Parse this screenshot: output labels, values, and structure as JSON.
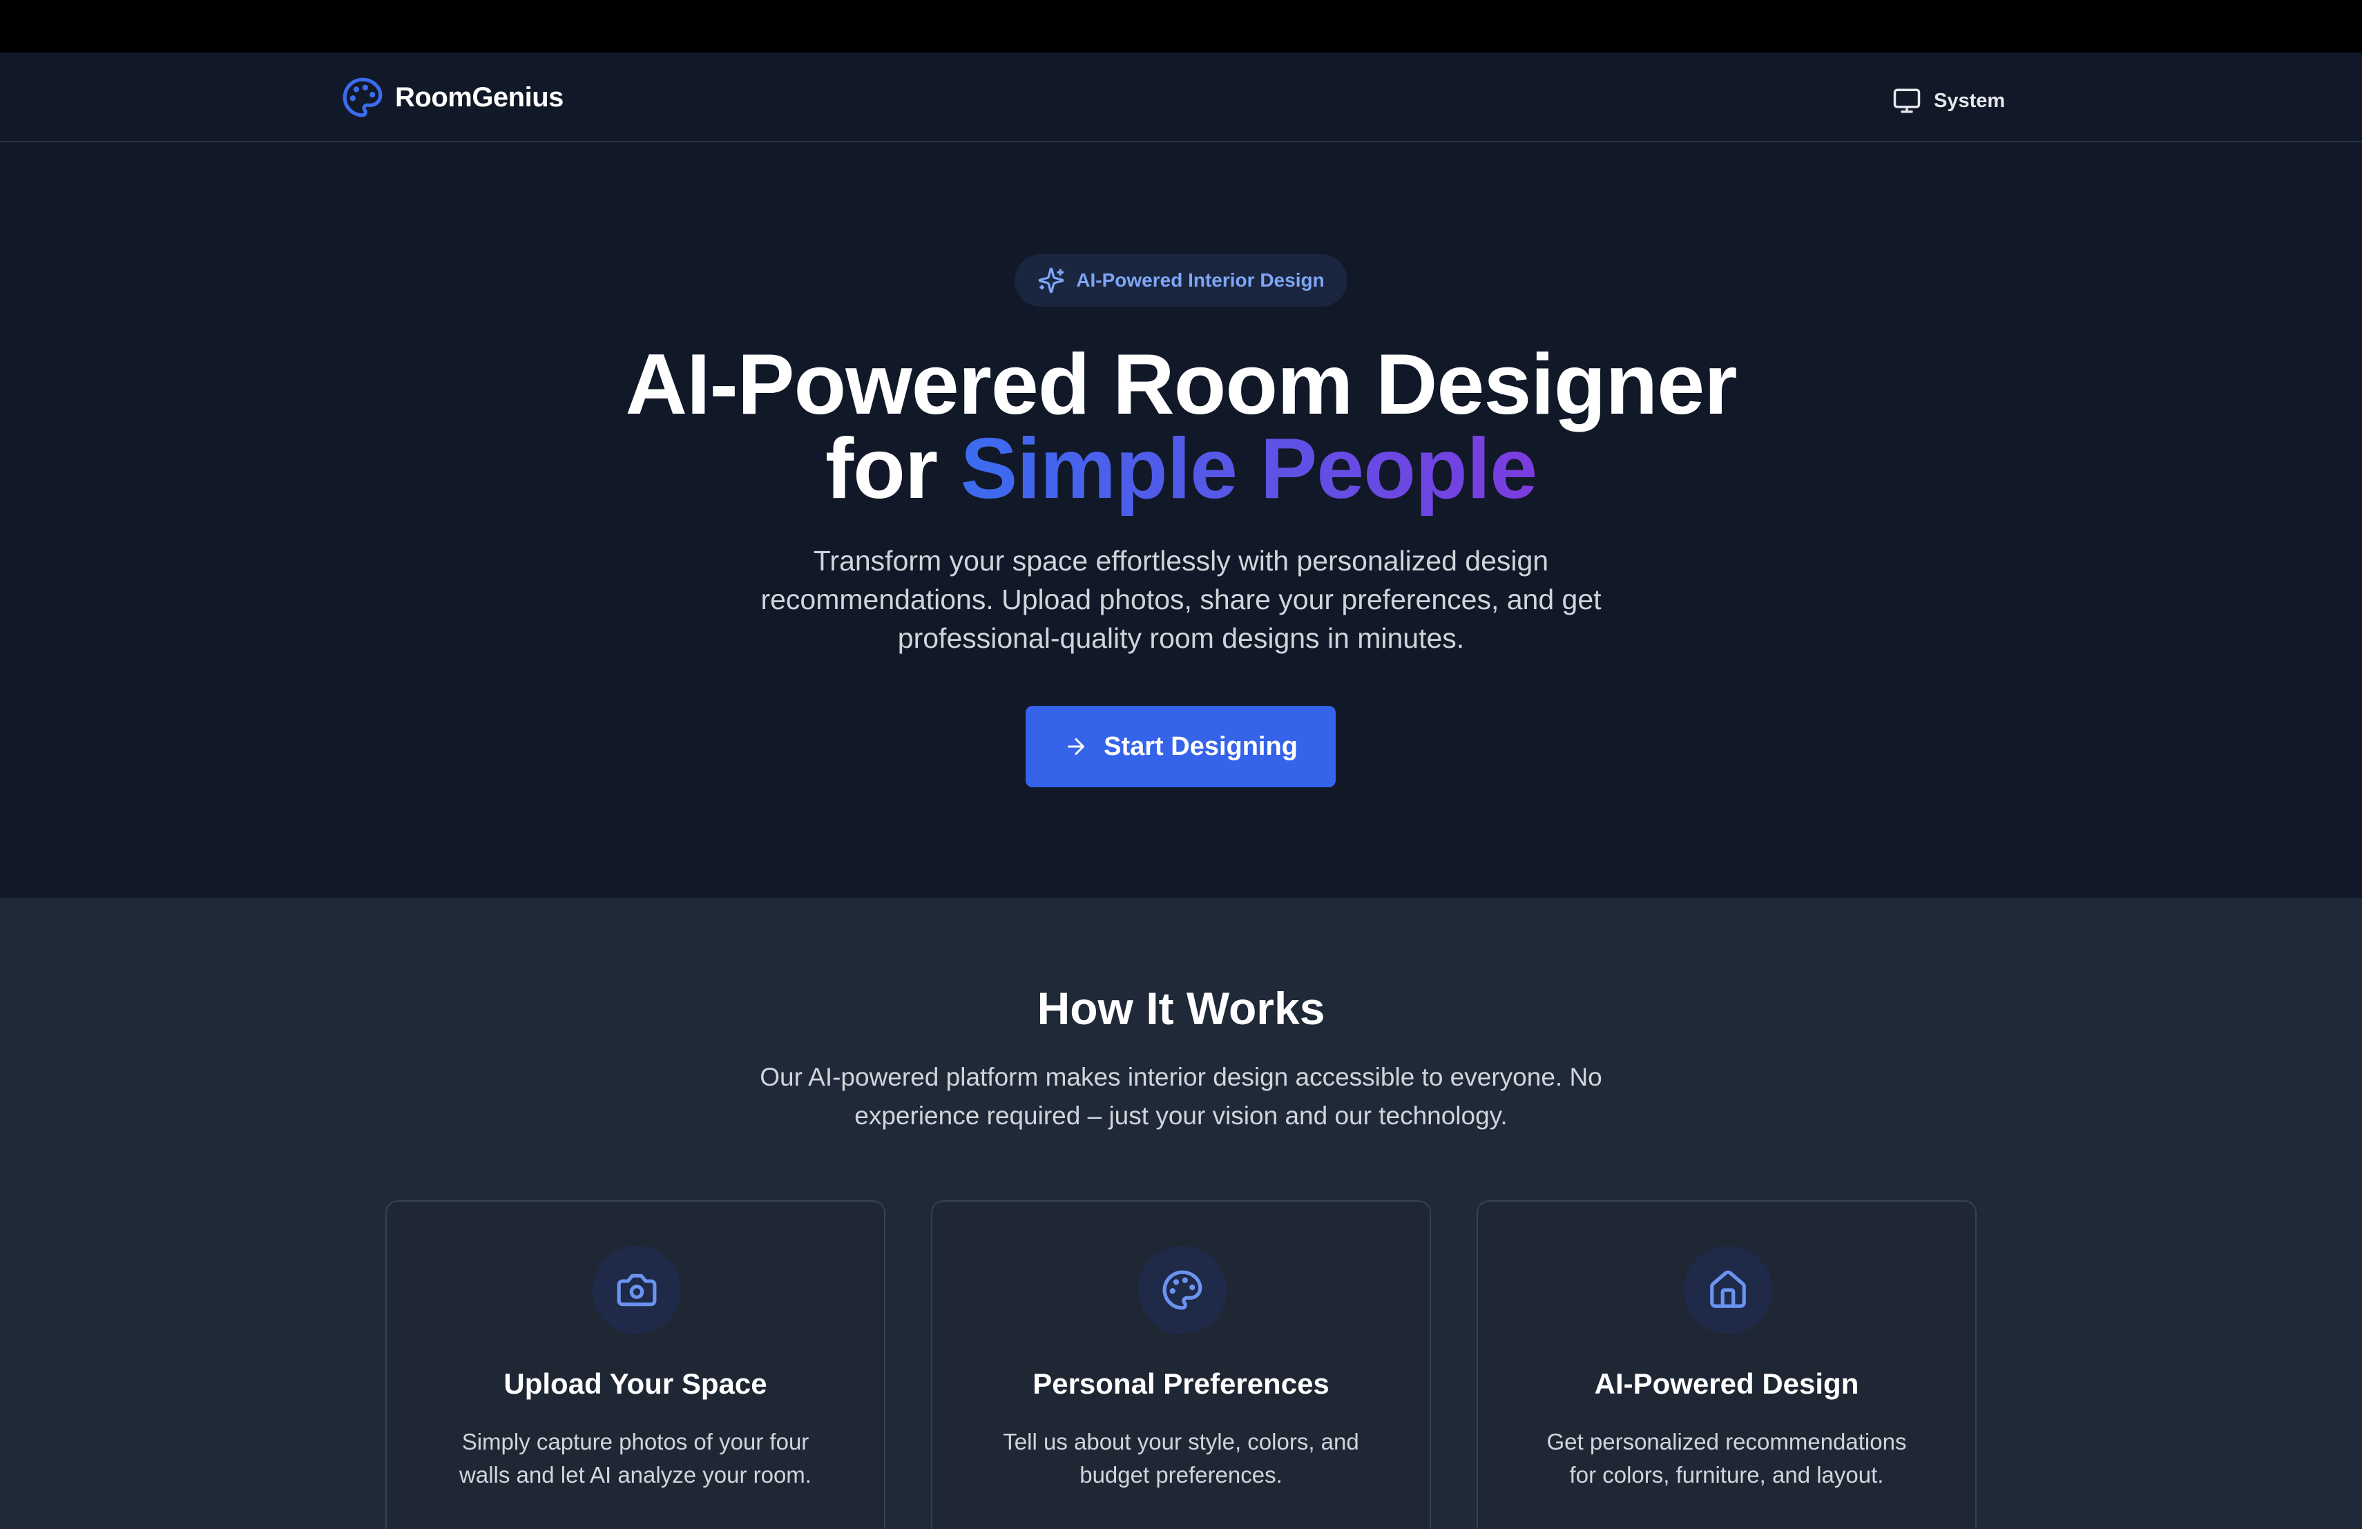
{
  "header": {
    "brand_name": "RoomGenius",
    "theme_label": "System"
  },
  "hero": {
    "badge": "AI-Powered Interior Design",
    "title_line1": "AI-Powered Room Designer",
    "title_line2_prefix": "for",
    "title_line2_highlight": "Simple People",
    "subtitle": "Transform your space effortlessly with personalized design recommendations. Upload photos, share your preferences, and get professional-quality room designs in minutes.",
    "cta_label": "Start Designing"
  },
  "how_it_works": {
    "title": "How It Works",
    "subtitle": "Our AI-powered platform makes interior design accessible to everyone. No experience required – just your vision and our technology.",
    "cards": [
      {
        "icon": "camera-icon",
        "title": "Upload Your Space",
        "description": "Simply capture photos of your four walls and let AI analyze your room."
      },
      {
        "icon": "palette-icon",
        "title": "Personal Preferences",
        "description": "Tell us about your style, colors, and budget preferences."
      },
      {
        "icon": "home-icon",
        "title": "AI-Powered Design",
        "description": "Get personalized recommendations for colors, furniture, and layout."
      }
    ]
  },
  "colors": {
    "accent": "#3563e9",
    "gradient_start": "#3b6cf0",
    "gradient_end": "#7c3ce0",
    "background": "#111827",
    "section_background": "#1f2937"
  }
}
